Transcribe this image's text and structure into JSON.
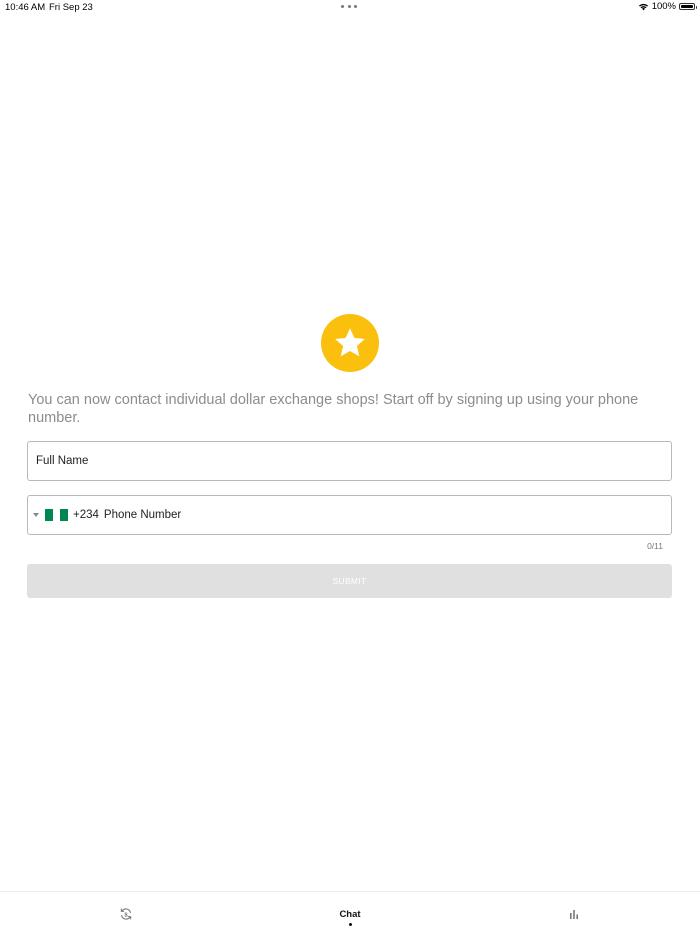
{
  "status_bar": {
    "time": "10:46 AM",
    "date": "Fri Sep 23",
    "battery_percent": "100%",
    "battery_level": 1.0,
    "icons": [
      "multitasking-dots-icon",
      "wifi-icon",
      "battery-icon"
    ]
  },
  "signup": {
    "badge_icon": "star-icon",
    "badge_color": "#FBBF0D",
    "intro_text": "You can now contact individual dollar exchange shops! Start off by signing up using your phone number.",
    "full_name": {
      "placeholder": "Full Name",
      "value": ""
    },
    "phone": {
      "country_flag": "nigeria-flag-icon",
      "dial_code": "+234",
      "placeholder": "Phone Number",
      "value": "",
      "char_counter": "0/11"
    },
    "submit_label": "SUBMIT"
  },
  "tab_bar": {
    "tabs": [
      {
        "icon": "currency-exchange-icon",
        "label": "",
        "active": false
      },
      {
        "icon": "",
        "label": "Chat",
        "active": true
      },
      {
        "icon": "bar-chart-icon",
        "label": "",
        "active": false
      }
    ]
  },
  "colors": {
    "accent_star": "#FBBF0D",
    "submit_disabled_bg": "#e0e0e0",
    "intro_text": "#8c8c8c",
    "flag_green": "#008751"
  }
}
